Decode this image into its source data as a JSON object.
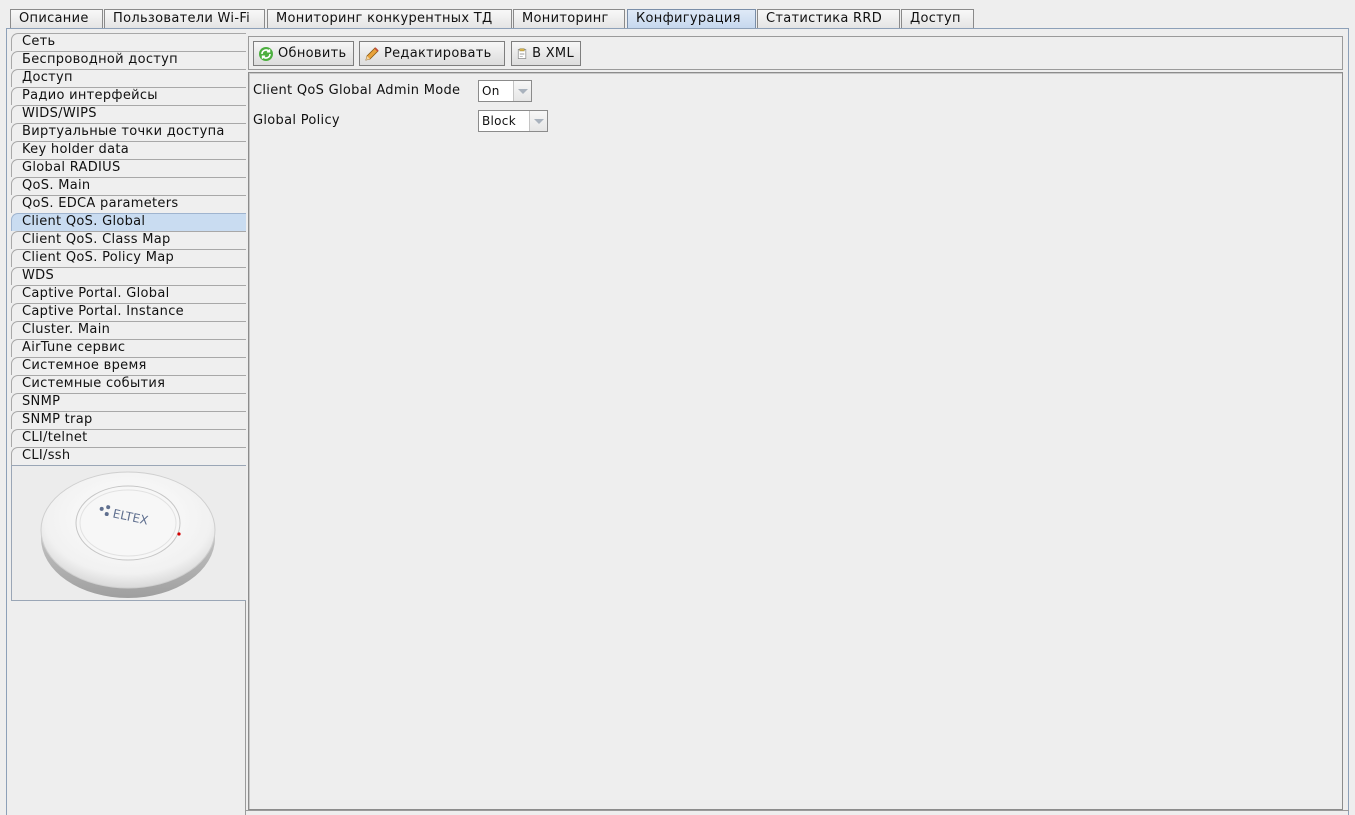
{
  "tabs": [
    {
      "label": "Описание"
    },
    {
      "label": "Пользователи Wi-Fi"
    },
    {
      "label": "Мониторинг конкурентных ТД"
    },
    {
      "label": "Мониторинг"
    },
    {
      "label": "Конфигурация"
    },
    {
      "label": "Статистика RRD"
    },
    {
      "label": "Доступ"
    }
  ],
  "active_tab": "Конфигурация",
  "sidebar": {
    "items": [
      {
        "label": "Сеть"
      },
      {
        "label": "Беспроводной доступ"
      },
      {
        "label": "Доступ"
      },
      {
        "label": "Радио интерфейсы"
      },
      {
        "label": "WIDS/WIPS"
      },
      {
        "label": "Виртуальные точки доступа"
      },
      {
        "label": "Key holder data"
      },
      {
        "label": "Global RADIUS"
      },
      {
        "label": "QoS. Main"
      },
      {
        "label": "QoS. EDCA parameters"
      },
      {
        "label": "Client QoS. Global"
      },
      {
        "label": "Client QoS. Class Map"
      },
      {
        "label": "Client QoS. Policy Map"
      },
      {
        "label": "WDS"
      },
      {
        "label": "Captive Portal. Global"
      },
      {
        "label": "Captive Portal. Instance"
      },
      {
        "label": "Cluster. Main"
      },
      {
        "label": "AirTune сервис"
      },
      {
        "label": "Системное время"
      },
      {
        "label": "Системные события"
      },
      {
        "label": "SNMP"
      },
      {
        "label": "SNMP trap"
      },
      {
        "label": "CLI/telnet"
      },
      {
        "label": "CLI/ssh"
      }
    ],
    "selected": "Client QoS. Global",
    "device_logo_text": "ELTEX"
  },
  "toolbar": {
    "refresh_label": "Обновить",
    "edit_label": "Редактировать",
    "xml_label": "В XML"
  },
  "form": {
    "admin_mode_label": "Client QoS Global Admin Mode",
    "admin_mode_value": "On",
    "policy_label": "Global Policy",
    "policy_value": "Block"
  },
  "colors": {
    "selection": "#c9dcf1",
    "active_tab": "#c6d8ee",
    "background": "#eeeeee"
  }
}
